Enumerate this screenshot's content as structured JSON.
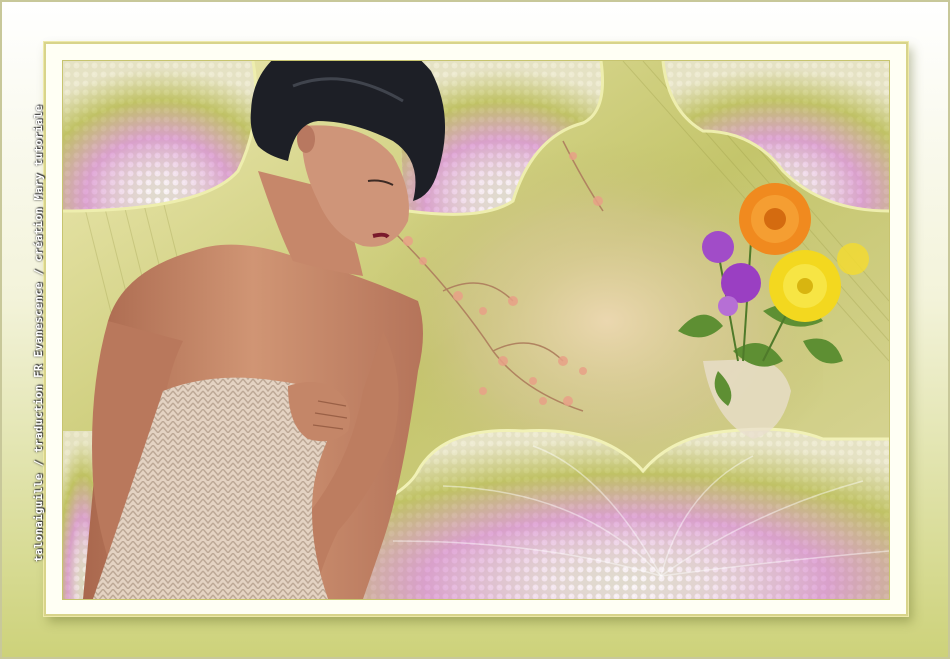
{
  "signature": {
    "text": "talonaiguille / traduction FR Evanescence / création Mary tutoriale"
  },
  "scene": {
    "subject": "woman-portrait",
    "background": "lattice-flower-design",
    "colors": {
      "frame": "#cdd27a",
      "pink": "#d98dc9",
      "olive": "#b9b95a",
      "skin": "#c88566",
      "hair": "#1d1f26",
      "knit": "#e7d6c6",
      "orange_flower": "#f08a1f",
      "yellow_flower": "#f3d81f",
      "purple_flower": "#a14cc8"
    }
  }
}
